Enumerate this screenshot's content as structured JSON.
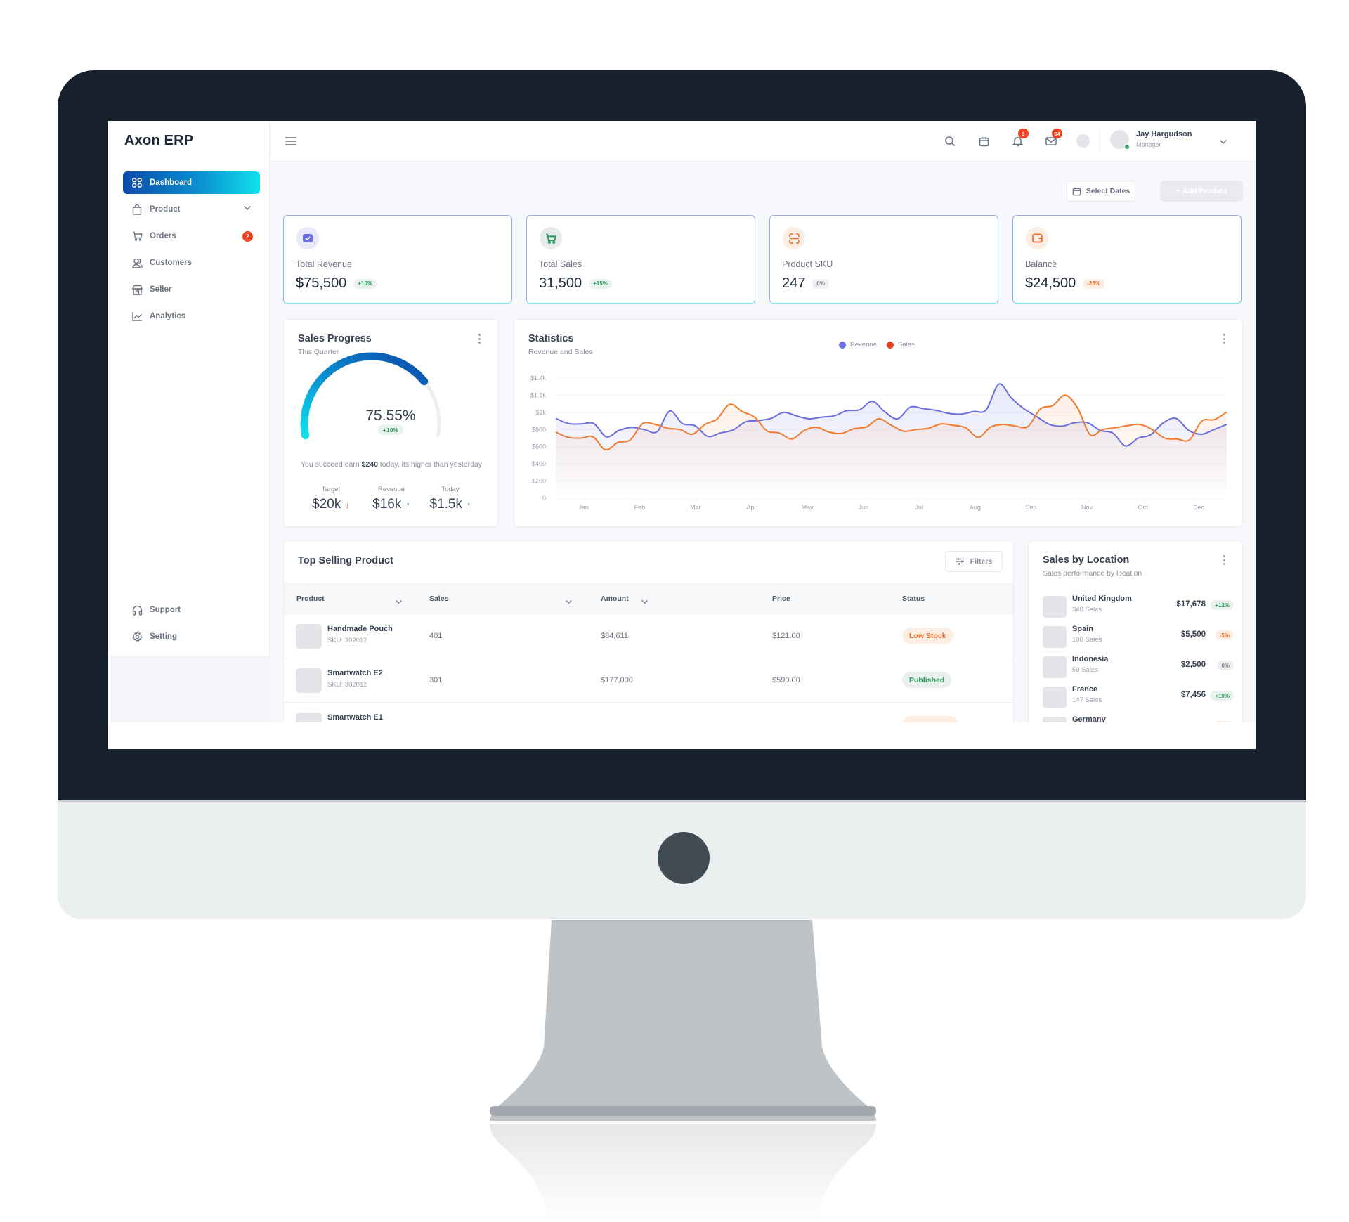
{
  "app": {
    "title": "Axon ERP"
  },
  "sidebar": {
    "items": [
      {
        "label": "Dashboard",
        "icon": "grid-icon",
        "active": true
      },
      {
        "label": "Product",
        "icon": "shopping-bag-icon",
        "has_submenu": true
      },
      {
        "label": "Orders",
        "icon": "cart-icon",
        "badge": "2"
      },
      {
        "label": "Customers",
        "icon": "users-icon"
      },
      {
        "label": "Seller",
        "icon": "store-icon"
      },
      {
        "label": "Analytics",
        "icon": "chart-line-icon"
      }
    ],
    "bottom_items": [
      {
        "label": "Support",
        "icon": "headphones-icon"
      },
      {
        "label": "Setting",
        "icon": "gear-icon"
      }
    ]
  },
  "header": {
    "notifications_count": "3",
    "messages_count": "64",
    "user": {
      "name": "Jay Hargudson",
      "role": "Manager",
      "status": "online"
    }
  },
  "actions": {
    "select_dates": "Select Dates",
    "add_product": "+ Add Product"
  },
  "stats": [
    {
      "label": "Total Revenue",
      "value": "$75,500",
      "change": "+10%",
      "trend": "green",
      "icon": "wallet-check-icon",
      "color": "#6c6fe0"
    },
    {
      "label": "Total Sales",
      "value": "31,500",
      "change": "+15%",
      "trend": "green",
      "icon": "cart-icon",
      "color": "#2f9a5e"
    },
    {
      "label": "Product SKU",
      "value": "247",
      "change": "0%",
      "trend": "gray",
      "icon": "scan-icon",
      "color": "#f06a2a"
    },
    {
      "label": "Balance",
      "value": "$24,500",
      "change": "-25%",
      "trend": "orange",
      "icon": "wallet-icon",
      "color": "#f06a2a"
    }
  ],
  "sales_progress": {
    "title": "Sales Progress",
    "subtitle": "This Quarter",
    "percent_label": "75.55%",
    "percent_value": 75.55,
    "change": "+10%",
    "message_pre": "You succeed earn ",
    "message_amount": "$240",
    "message_post": " today, its higher than yesterday",
    "stats": [
      {
        "label": "Target",
        "value": "$20k",
        "trend": "down"
      },
      {
        "label": "Revenue",
        "value": "$16k",
        "trend": "up"
      },
      {
        "label": "Today",
        "value": "$1.5k",
        "trend": "up"
      }
    ]
  },
  "chart_data": {
    "type": "area",
    "title": "Statistics",
    "subtitle": "Revenue and Sales",
    "xlabel": "",
    "ylabel": "",
    "ylim": [
      0,
      1400
    ],
    "yticks": [
      0,
      200,
      400,
      600,
      800,
      1000,
      1200,
      1400
    ],
    "ytick_labels": [
      "0",
      "$200",
      "$400",
      "$600",
      "$800",
      "$1k",
      "$1.2k",
      "$1.4k"
    ],
    "categories": [
      "Jan",
      "Feb",
      "Mar",
      "Apr",
      "May",
      "Jun",
      "Jul",
      "Aug",
      "Sep",
      "Nov",
      "Oct",
      "Dec"
    ],
    "grid": true,
    "legend": "top-center",
    "series": [
      {
        "name": "Revenue",
        "color": "#6a6fe0",
        "values": [
          930,
          870,
          865,
          870,
          715,
          790,
          825,
          800,
          775,
          1015,
          870,
          845,
          720,
          760,
          795,
          890,
          905,
          930,
          1000,
          960,
          925,
          945,
          960,
          1020,
          1030,
          1130,
          1005,
          925,
          1060,
          1045,
          1025,
          990,
          980,
          1010,
          1030,
          1330,
          1165,
          1040,
          950,
          860,
          840,
          880,
          880,
          790,
          760,
          610,
          700,
          740,
          880,
          930,
          790,
          745,
          800,
          860
        ]
      },
      {
        "name": "Sales",
        "color": "#f27a2f",
        "values": [
          770,
          710,
          700,
          715,
          565,
          650,
          680,
          870,
          860,
          815,
          800,
          745,
          860,
          925,
          1095,
          1010,
          945,
          785,
          760,
          690,
          790,
          825,
          770,
          755,
          810,
          830,
          925,
          850,
          780,
          800,
          815,
          865,
          850,
          820,
          710,
          830,
          860,
          840,
          835,
          1040,
          1080,
          1200,
          1050,
          740,
          800,
          820,
          845,
          860,
          800,
          700,
          690,
          680,
          900,
          915,
          1005
        ]
      }
    ]
  },
  "top_selling": {
    "title": "Top Selling Product",
    "filters_label": "Filters",
    "columns": [
      "Product",
      "Sales",
      "Amount",
      "Price",
      "Status"
    ],
    "rows": [
      {
        "name": "Handmade Pouch",
        "sku": "SKU: 302012",
        "sales": "401",
        "amount": "$84,611",
        "price": "$121.00",
        "status": "Low Stock",
        "status_type": "low"
      },
      {
        "name": "Smartwatch E2",
        "sku": "SKU: 302012",
        "sales": "301",
        "amount": "$177,000",
        "price": "$590.00",
        "status": "Published",
        "status_type": "pub"
      },
      {
        "name": "Smartwatch E1",
        "sku": "",
        "sales": "",
        "amount": "",
        "price": "",
        "status": "",
        "status_type": "low"
      }
    ]
  },
  "sales_by_location": {
    "title": "Sales by Location",
    "subtitle": "Sales performance by location",
    "items": [
      {
        "country": "United Kingdom",
        "sales": "340 Sales",
        "amount": "$17,678",
        "change": "+12%",
        "trend": "green"
      },
      {
        "country": "Spain",
        "sales": "100 Sales",
        "amount": "$5,500",
        "change": "-5%",
        "trend": "orange"
      },
      {
        "country": "Indonesia",
        "sales": "50 Sales",
        "amount": "$2,500",
        "change": "0%",
        "trend": "gray"
      },
      {
        "country": "France",
        "sales": "147 Sales",
        "amount": "$7,456",
        "change": "+19%",
        "trend": "green"
      },
      {
        "country": "Germany",
        "sales": "",
        "amount": "",
        "change": "",
        "trend": "orange"
      }
    ]
  }
}
